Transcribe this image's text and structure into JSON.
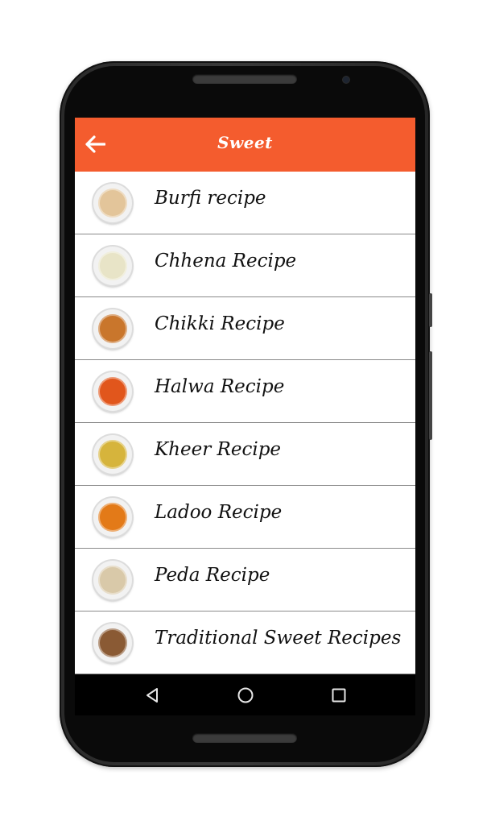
{
  "app_bar": {
    "title": "Sweet",
    "back_icon": "arrow-left-icon",
    "color": "#f45c2e"
  },
  "list": {
    "items": [
      {
        "label": "Burfi recipe",
        "icon": "burfi-thumbnail",
        "color": "#e3c59a"
      },
      {
        "label": "Chhena Recipe",
        "icon": "chhena-thumbnail",
        "color": "#e8e4c7"
      },
      {
        "label": "Chikki Recipe",
        "icon": "chikki-thumbnail",
        "color": "#c9762c"
      },
      {
        "label": "Halwa Recipe",
        "icon": "halwa-thumbnail",
        "color": "#e1561c"
      },
      {
        "label": "Kheer Recipe",
        "icon": "kheer-thumbnail",
        "color": "#d6b43c"
      },
      {
        "label": "Ladoo Recipe",
        "icon": "ladoo-thumbnail",
        "color": "#e37a18"
      },
      {
        "label": "Peda Recipe",
        "icon": "peda-thumbnail",
        "color": "#d9c9a9"
      },
      {
        "label": "Traditional Sweet Recipes",
        "icon": "cake-thumbnail",
        "color": "#8a5a34"
      }
    ]
  },
  "nav_bar": {
    "back_icon": "triangle-back-icon",
    "home_icon": "circle-home-icon",
    "recents_icon": "square-recents-icon"
  }
}
